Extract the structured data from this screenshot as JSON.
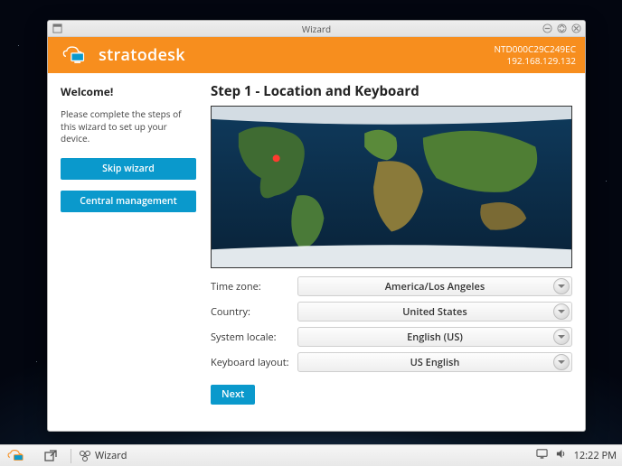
{
  "window": {
    "title": "Wizard"
  },
  "banner": {
    "brand": "stratodesk",
    "device_id": "NTD000C29C249EC",
    "ip": "192.168.129.132"
  },
  "sidebar": {
    "heading": "Welcome!",
    "description": "Please complete the steps of this wizard to set up your device.",
    "skip_label": "Skip wizard",
    "central_label": "Central management"
  },
  "main": {
    "step_heading": "Step 1 - Location and Keyboard",
    "fields": [
      {
        "label": "Time zone:",
        "value": "America/Los Angeles"
      },
      {
        "label": "Country:",
        "value": "United States"
      },
      {
        "label": "System locale:",
        "value": "English (US)"
      },
      {
        "label": "Keyboard layout:",
        "value": "US English"
      }
    ],
    "next_label": "Next"
  },
  "taskbar": {
    "task_label": "Wizard",
    "clock": "12:22 PM"
  }
}
